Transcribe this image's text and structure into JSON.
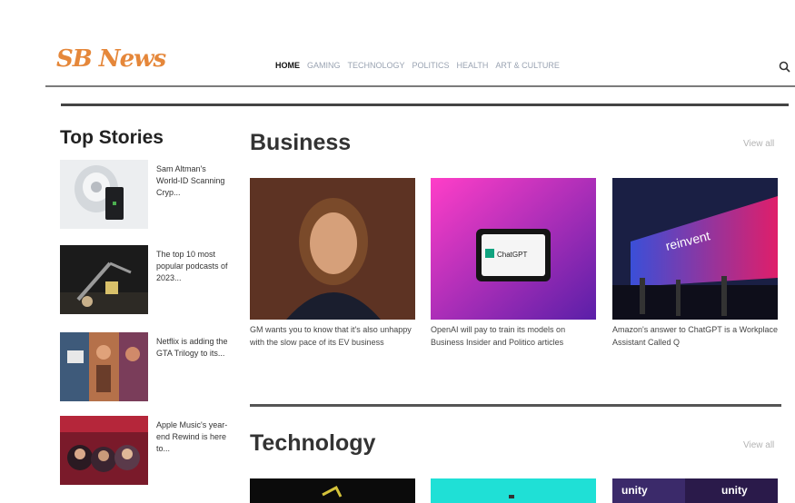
{
  "header": {
    "logo": "SB News",
    "nav": [
      "HOME",
      "GAMING",
      "TECHNOLOGY",
      "POLITICS",
      "HEALTH",
      "ART & CULTURE"
    ],
    "search_icon": "search-icon"
  },
  "sidebar": {
    "title": "Top Stories",
    "stories": [
      {
        "text": "Sam Altman's World-ID Scanning Cryp..."
      },
      {
        "text": "The top 10 most popular podcasts of 2023..."
      },
      {
        "text": "Netflix is adding the GTA Trilogy to its..."
      },
      {
        "text": "Apple Music's year-end Rewind is here to..."
      }
    ]
  },
  "business": {
    "title": "Business",
    "view_all": "View all",
    "cards": [
      {
        "caption": "GM wants you to know that it's also unhappy with the slow pace of its EV business"
      },
      {
        "caption": "OpenAI will pay to train its models on Business Insider and Politico articles",
        "screen_text": "ChatGPT"
      },
      {
        "caption": "Amazon's answer to ChatGPT is a Workplace Assistant Called Q",
        "banner_text": "reinvent"
      }
    ]
  },
  "technology": {
    "title": "Technology",
    "view_all": "View all",
    "banner_texts": [
      "unity",
      "unity"
    ]
  },
  "colors": {
    "logo": "#e5873a",
    "nav_muted": "#9aa3b2",
    "rule": "#444444"
  }
}
